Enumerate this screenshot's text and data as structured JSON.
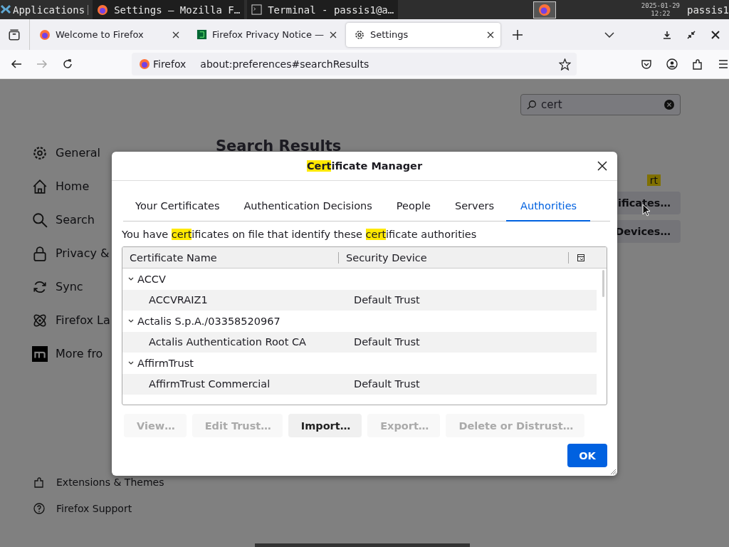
{
  "taskbar": {
    "apps_menu": "Applications",
    "windows": [
      {
        "title": "Settings — Mozilla F…",
        "selected": false
      },
      {
        "title": "Terminal - passis1@a…",
        "selected": false
      }
    ],
    "date": "2025-01-29",
    "time": "12:22",
    "user": "passis1"
  },
  "browser": {
    "tabs": [
      {
        "title": "Welcome to Firefox",
        "selected": false
      },
      {
        "title": "Firefox Privacy Notice —",
        "selected": false
      },
      {
        "title": "Settings",
        "selected": true
      }
    ],
    "identity": "Firefox",
    "url": "about:preferences#searchResults"
  },
  "settings": {
    "search": {
      "value": "cert"
    },
    "heading": "Search Results",
    "sidebar": [
      {
        "label": "General"
      },
      {
        "label": "Home"
      },
      {
        "label": "Search"
      },
      {
        "label": "Privacy &"
      },
      {
        "label": "Sync"
      },
      {
        "label": "Firefox La"
      },
      {
        "label": "More fro"
      }
    ],
    "sidebar_footer": [
      {
        "label": "Extensions & Themes"
      },
      {
        "label": "Firefox Support"
      }
    ],
    "result_highlight": "rt",
    "result_buttons": [
      "ificates…",
      "Devices…"
    ]
  },
  "dialog": {
    "title": [
      {
        "text": "Cert",
        "highlight": true
      },
      {
        "text": "ificate Manager",
        "highlight": false
      }
    ],
    "tabs": [
      {
        "label": "Your Certificates",
        "selected": false
      },
      {
        "label": "Authentication Decisions",
        "selected": false
      },
      {
        "label": "People",
        "selected": false
      },
      {
        "label": "Servers",
        "selected": false
      },
      {
        "label": "Authorities",
        "selected": true
      }
    ],
    "description": [
      {
        "text": "You have ",
        "highlight": false
      },
      {
        "text": "cert",
        "highlight": true
      },
      {
        "text": "ificates on file that identify these ",
        "highlight": false
      },
      {
        "text": "cert",
        "highlight": true
      },
      {
        "text": "ificate authorities",
        "highlight": false
      }
    ],
    "columns": [
      "Certificate Name",
      "Security Device"
    ],
    "tree": [
      {
        "name": "ACCV",
        "expanded": true,
        "children": [
          {
            "name": "ACCVRAIZ1",
            "device": "Default Trust"
          }
        ]
      },
      {
        "name": "Actalis S.p.A./03358520967",
        "expanded": true,
        "children": [
          {
            "name": "Actalis Authentication Root CA",
            "device": "Default Trust"
          }
        ]
      },
      {
        "name": "AffirmTrust",
        "expanded": true,
        "children": [
          {
            "name": "AffirmTrust Commercial",
            "device": "Default Trust"
          }
        ]
      }
    ],
    "buttons": [
      {
        "label": "View…",
        "disabled": true
      },
      {
        "label": "Edit Trust…",
        "disabled": true
      },
      {
        "label": "Import…",
        "disabled": false
      },
      {
        "label": "Export…",
        "disabled": true
      },
      {
        "label": "Delete or Distrust…",
        "disabled": true
      }
    ],
    "ok": "OK"
  }
}
